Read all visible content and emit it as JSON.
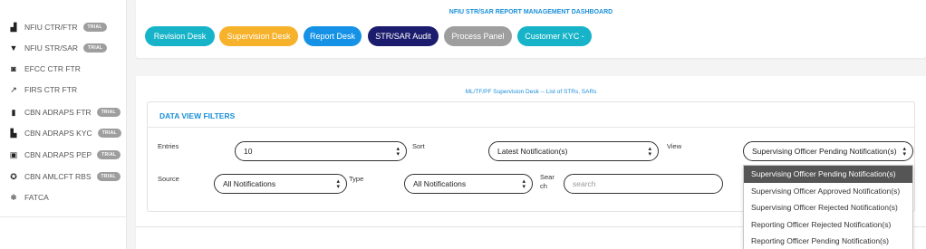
{
  "sidebar": {
    "items": [
      {
        "label": "NFIU CTR/FTR",
        "icon": "bar-chart-icon",
        "glyph": "▟",
        "trial": "TRIAL"
      },
      {
        "label": "NFIU STR/SAR",
        "icon": "filter-icon",
        "glyph": "▼",
        "trial": "TRIAL"
      },
      {
        "label": "EFCC CTR FTR",
        "icon": "badge-icon",
        "glyph": "◙",
        "trial": ""
      },
      {
        "label": "FIRS CTR FTR",
        "icon": "trend-icon",
        "glyph": "↗",
        "trial": ""
      },
      {
        "label": "CBN ADRAPS FTR",
        "icon": "map-icon",
        "glyph": "▮",
        "trial": "TRIAL"
      },
      {
        "label": "CBN ADRAPS KYC",
        "icon": "file-icon",
        "glyph": "▙",
        "trial": "TRIAL"
      },
      {
        "label": "CBN ADRAPS PEP",
        "icon": "image-icon",
        "glyph": "▣",
        "trial": "TRIAL"
      },
      {
        "label": "CBN AMLCFT RBS",
        "icon": "globe-icon",
        "glyph": "✪",
        "trial": "TRIAL"
      },
      {
        "label": "FATCA",
        "icon": "snowflake-icon",
        "glyph": "❄",
        "trial": ""
      }
    ]
  },
  "dashboard": {
    "title": "NFIU STR/SAR REPORT MANAGEMENT DASHBOARD",
    "buttons": [
      {
        "label": "Revision Desk",
        "color": "#17b4c9"
      },
      {
        "label": "Supervision Desk",
        "color": "#f7b22c"
      },
      {
        "label": "Report Desk",
        "color": "#1592e6"
      },
      {
        "label": "STR/SAR Audit",
        "color": "#1c1c6e"
      },
      {
        "label": "Process Panel",
        "color": "#9e9e9e"
      },
      {
        "label": "Customer KYC -",
        "color": "#17b4c9"
      }
    ]
  },
  "desk": {
    "title": "ML/TF/PF Supervision Desk -- List of STRs, SARs"
  },
  "filters": {
    "title": "DATA VIEW FILTERS",
    "entries_label": "Entries",
    "entries_value": "10",
    "sort_label": "Sort",
    "sort_value": "Latest Notification(s)",
    "view_label": "View",
    "view_value": "Supervising Officer Pending Notification(s)",
    "source_label": "Source",
    "source_value": "All Notifications",
    "type_label": "Type",
    "type_value": "All Notifications",
    "search_label_1": "Sear",
    "search_label_2": "ch",
    "search_placeholder": "search"
  },
  "view_options": [
    "Supervising Officer Pending Notification(s)",
    "Supervising Officer Approved Notification(s)",
    "Supervising Officer Rejected Notification(s)",
    "Reporting Officer Rejected Notification(s)",
    "Reporting Officer Pending Notification(s)"
  ]
}
